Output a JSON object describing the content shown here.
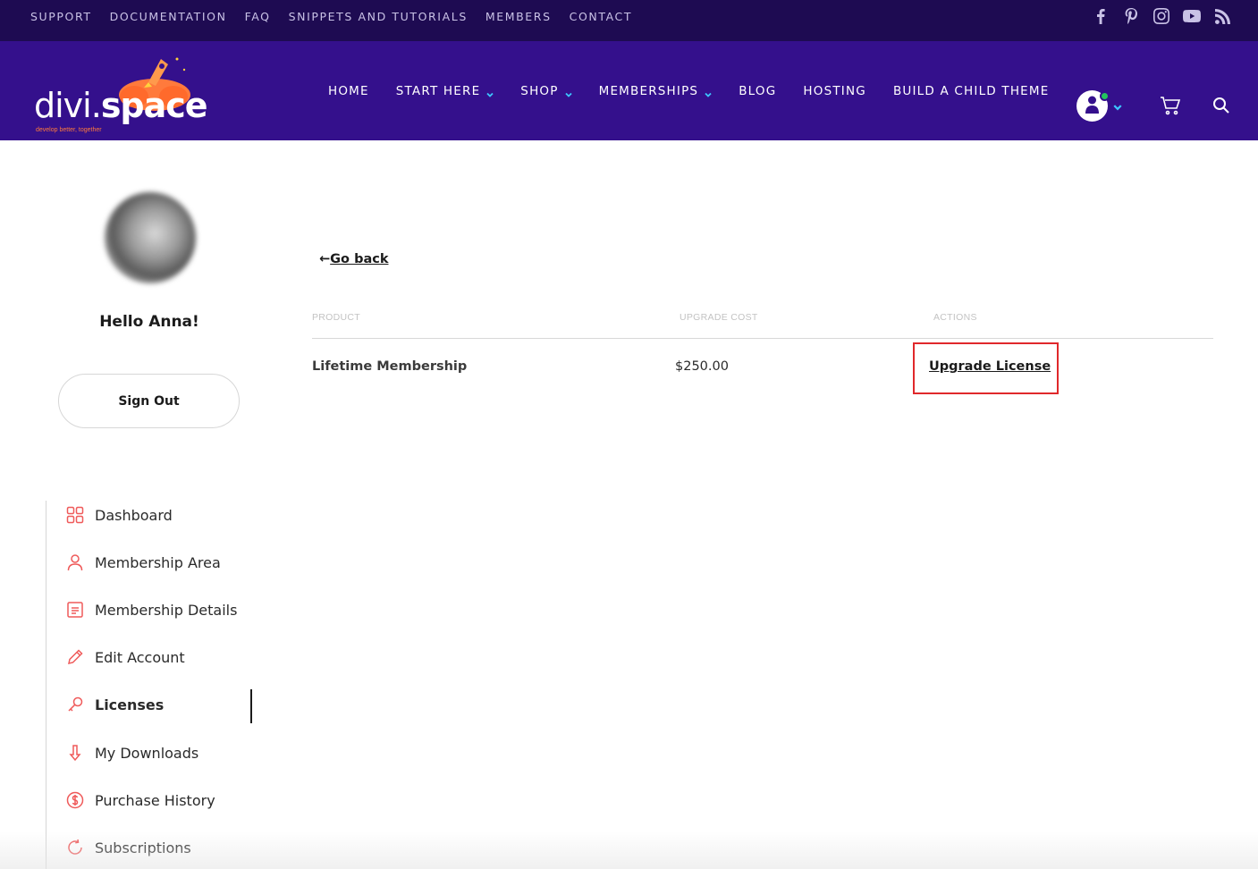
{
  "topbar": {
    "links": [
      "SUPPORT",
      "DOCUMENTATION",
      "FAQ",
      "SNIPPETS AND TUTORIALS",
      "MEMBERS",
      "CONTACT"
    ],
    "social_icons": [
      "facebook-icon",
      "pinterest-icon",
      "instagram-icon",
      "youtube-icon",
      "rss-icon"
    ]
  },
  "header": {
    "logo_main": "divi.",
    "logo_bold": "space",
    "logo_tagline": "develop better, together",
    "nav": [
      {
        "label": "HOME"
      },
      {
        "label": "START HERE"
      },
      {
        "label": "SHOP"
      },
      {
        "label": "MEMBERSHIPS"
      },
      {
        "label": "BLOG"
      },
      {
        "label": "HOSTING"
      },
      {
        "label": "BUILD A CHILD THEME"
      }
    ]
  },
  "sidebar": {
    "greeting": "Hello Anna!",
    "sign_out": "Sign Out",
    "items": [
      {
        "label": "Dashboard",
        "icon": "grid-icon"
      },
      {
        "label": "Membership Area",
        "icon": "user-icon"
      },
      {
        "label": "Membership Details",
        "icon": "document-icon"
      },
      {
        "label": "Edit Account",
        "icon": "pencil-icon"
      },
      {
        "label": "Licenses",
        "icon": "key-icon"
      },
      {
        "label": "My Downloads",
        "icon": "download-icon"
      },
      {
        "label": "Purchase History",
        "icon": "dollar-icon"
      },
      {
        "label": "Subscriptions",
        "icon": "refresh-icon"
      }
    ]
  },
  "main": {
    "go_back": "Go back",
    "go_back_arrow": "←",
    "table": {
      "headers": [
        "PRODUCT",
        "UPGRADE COST",
        "ACTIONS"
      ],
      "rows": [
        {
          "product": "Lifetime Membership",
          "cost": "$250.00",
          "action": "Upgrade License"
        }
      ]
    }
  },
  "colors": {
    "topbar": "#1e0b52",
    "header": "#34108c",
    "accent_icon": "#ef5a5a",
    "highlight_box": "#e0282b",
    "chevron": "#3cc6ff"
  }
}
